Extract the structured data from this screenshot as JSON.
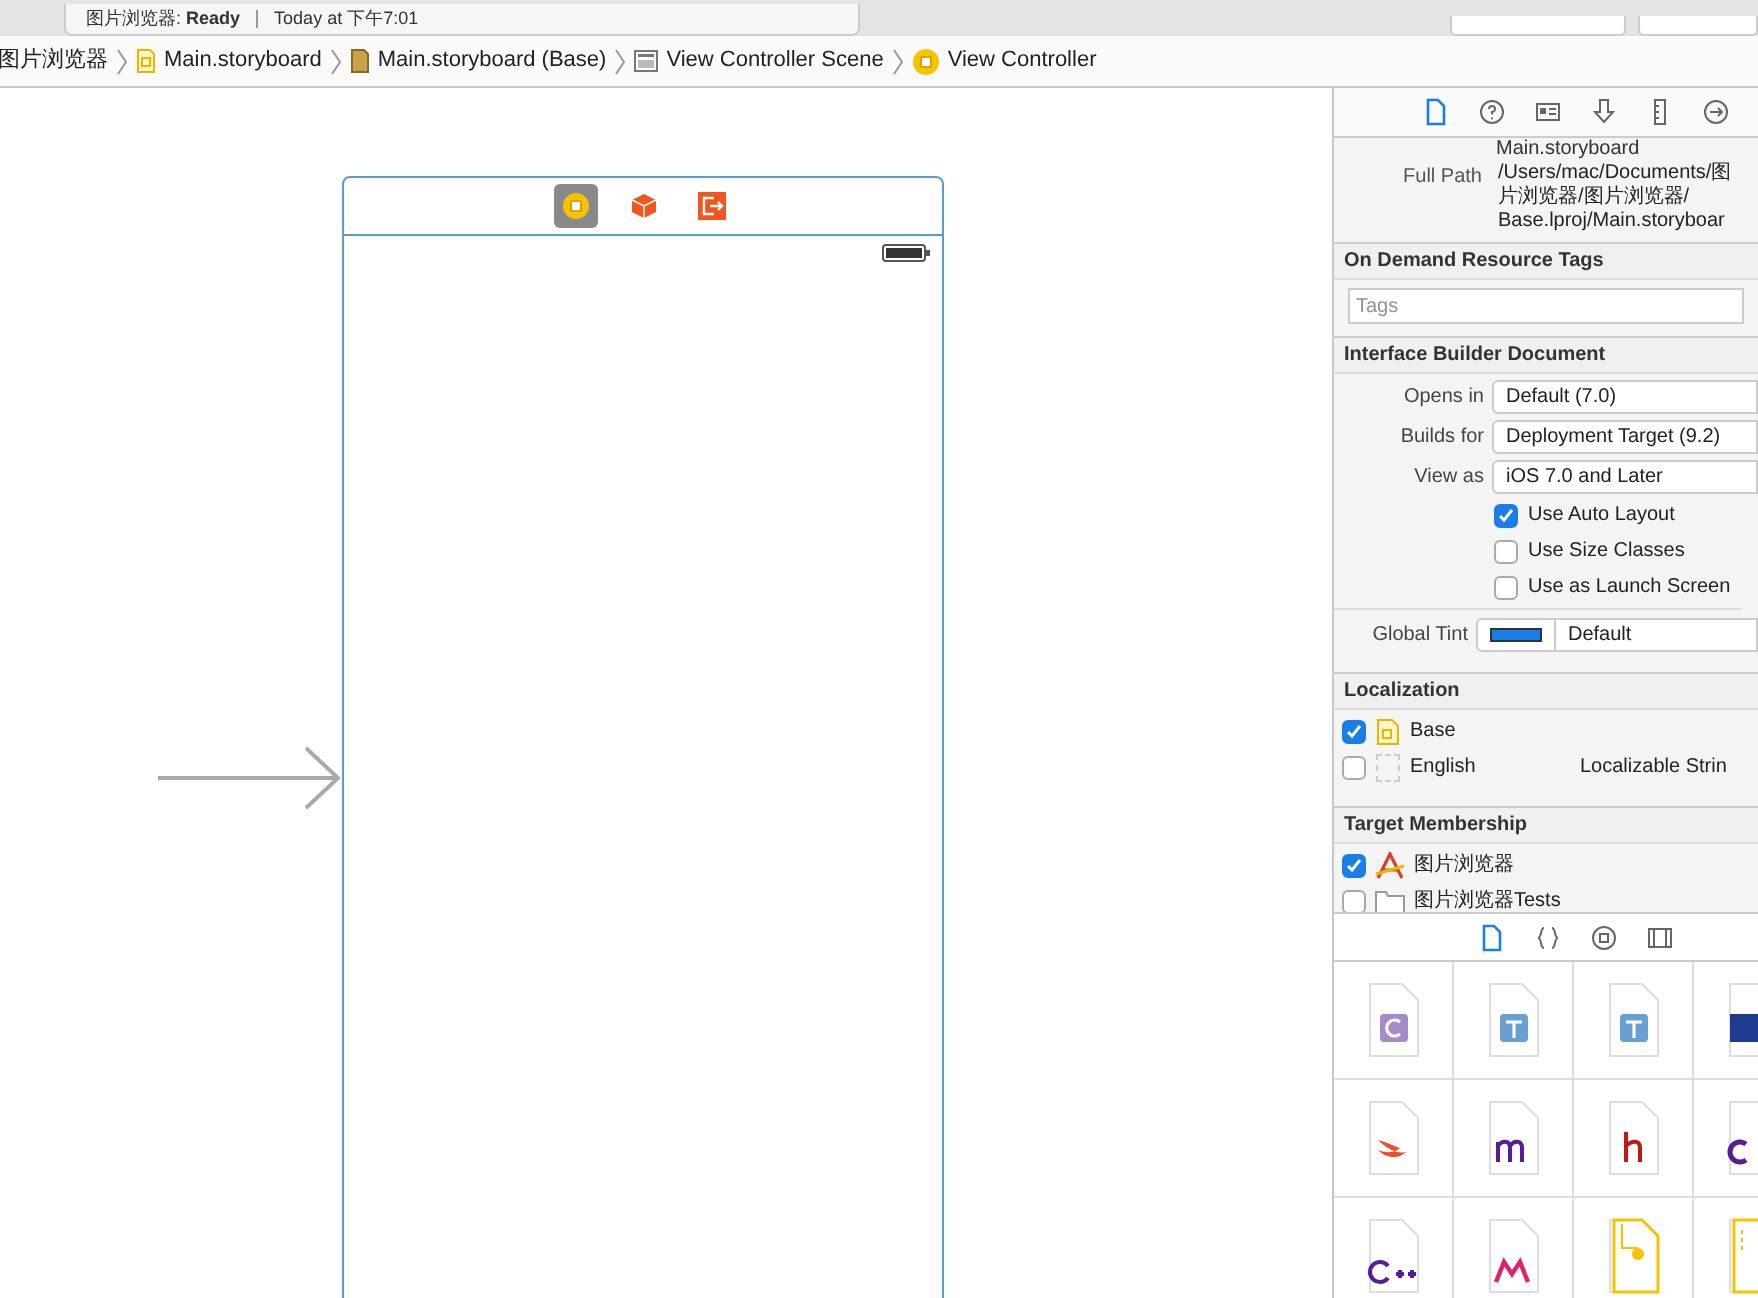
{
  "status": {
    "project": "图片浏览器:",
    "state": "Ready",
    "time": "Today at 下午7:01"
  },
  "breadcrumb": [
    {
      "label": "图片浏览器",
      "kind": "project"
    },
    {
      "label": "Main.storyboard",
      "kind": "storyboard"
    },
    {
      "label": "Main.storyboard (Base)",
      "kind": "base"
    },
    {
      "label": "View Controller Scene",
      "kind": "scene"
    },
    {
      "label": "View Controller",
      "kind": "controller"
    }
  ],
  "scene": {
    "dock": [
      {
        "kind": "controller",
        "selected": true
      },
      {
        "kind": "responder",
        "selected": false
      },
      {
        "kind": "exit",
        "selected": false
      }
    ]
  },
  "inspector": {
    "tabs": [
      {
        "kind": "file",
        "selected": true
      },
      {
        "kind": "help",
        "selected": false
      },
      {
        "kind": "identity",
        "selected": false
      },
      {
        "kind": "attributes",
        "selected": false
      },
      {
        "kind": "size",
        "selected": false
      },
      {
        "kind": "connections",
        "selected": false
      }
    ],
    "file_name": "Main.storyboard",
    "full_path": {
      "label": "Full Path",
      "lines": [
        "/Users/mac/Documents/图",
        "片浏览器/图片浏览器/",
        "Base.lproj/Main.storyboar"
      ]
    },
    "tags": {
      "title": "On Demand Resource Tags",
      "placeholder": "Tags"
    },
    "ib_document": {
      "title": "Interface Builder Document",
      "popups": [
        {
          "label": "Opens in",
          "value": "Default (7.0)"
        },
        {
          "label": "Builds for",
          "value": "Deployment Target (9.2)"
        },
        {
          "label": "View as",
          "value": "iOS 7.0 and Later"
        }
      ],
      "checkboxes": [
        {
          "label": "Use Auto Layout",
          "checked": true
        },
        {
          "label": "Use Size Classes",
          "checked": false
        },
        {
          "label": "Use as Launch Screen",
          "checked": false
        }
      ],
      "tint": {
        "label": "Global Tint",
        "value": "Default",
        "color": "#1a7ee8"
      }
    },
    "localization": {
      "title": "Localization",
      "items": [
        {
          "label": "Base",
          "checked": true,
          "kind": "file"
        },
        {
          "label": "English",
          "checked": false,
          "kind": "blank",
          "note": "Localizable Strin"
        }
      ]
    },
    "targets": {
      "title": "Target Membership",
      "items": [
        {
          "label": "图片浏览器",
          "checked": true,
          "kind": "app"
        },
        {
          "label": "图片浏览器Tests",
          "checked": false,
          "kind": "folder"
        }
      ]
    }
  },
  "library": {
    "tabs": [
      {
        "kind": "file",
        "selected": true
      },
      {
        "kind": "snippet",
        "selected": false
      },
      {
        "kind": "object",
        "selected": false
      },
      {
        "kind": "media",
        "selected": false
      }
    ],
    "items": [
      {
        "kind": "c"
      },
      {
        "kind": "text"
      },
      {
        "kind": "text"
      },
      {
        "kind": "image"
      },
      {
        "kind": "swift"
      },
      {
        "kind": "m"
      },
      {
        "kind": "h"
      },
      {
        "kind": "c2"
      },
      {
        "kind": "cpp"
      },
      {
        "kind": "metal"
      },
      {
        "kind": "storyboard"
      },
      {
        "kind": "storyboard2"
      }
    ]
  }
}
